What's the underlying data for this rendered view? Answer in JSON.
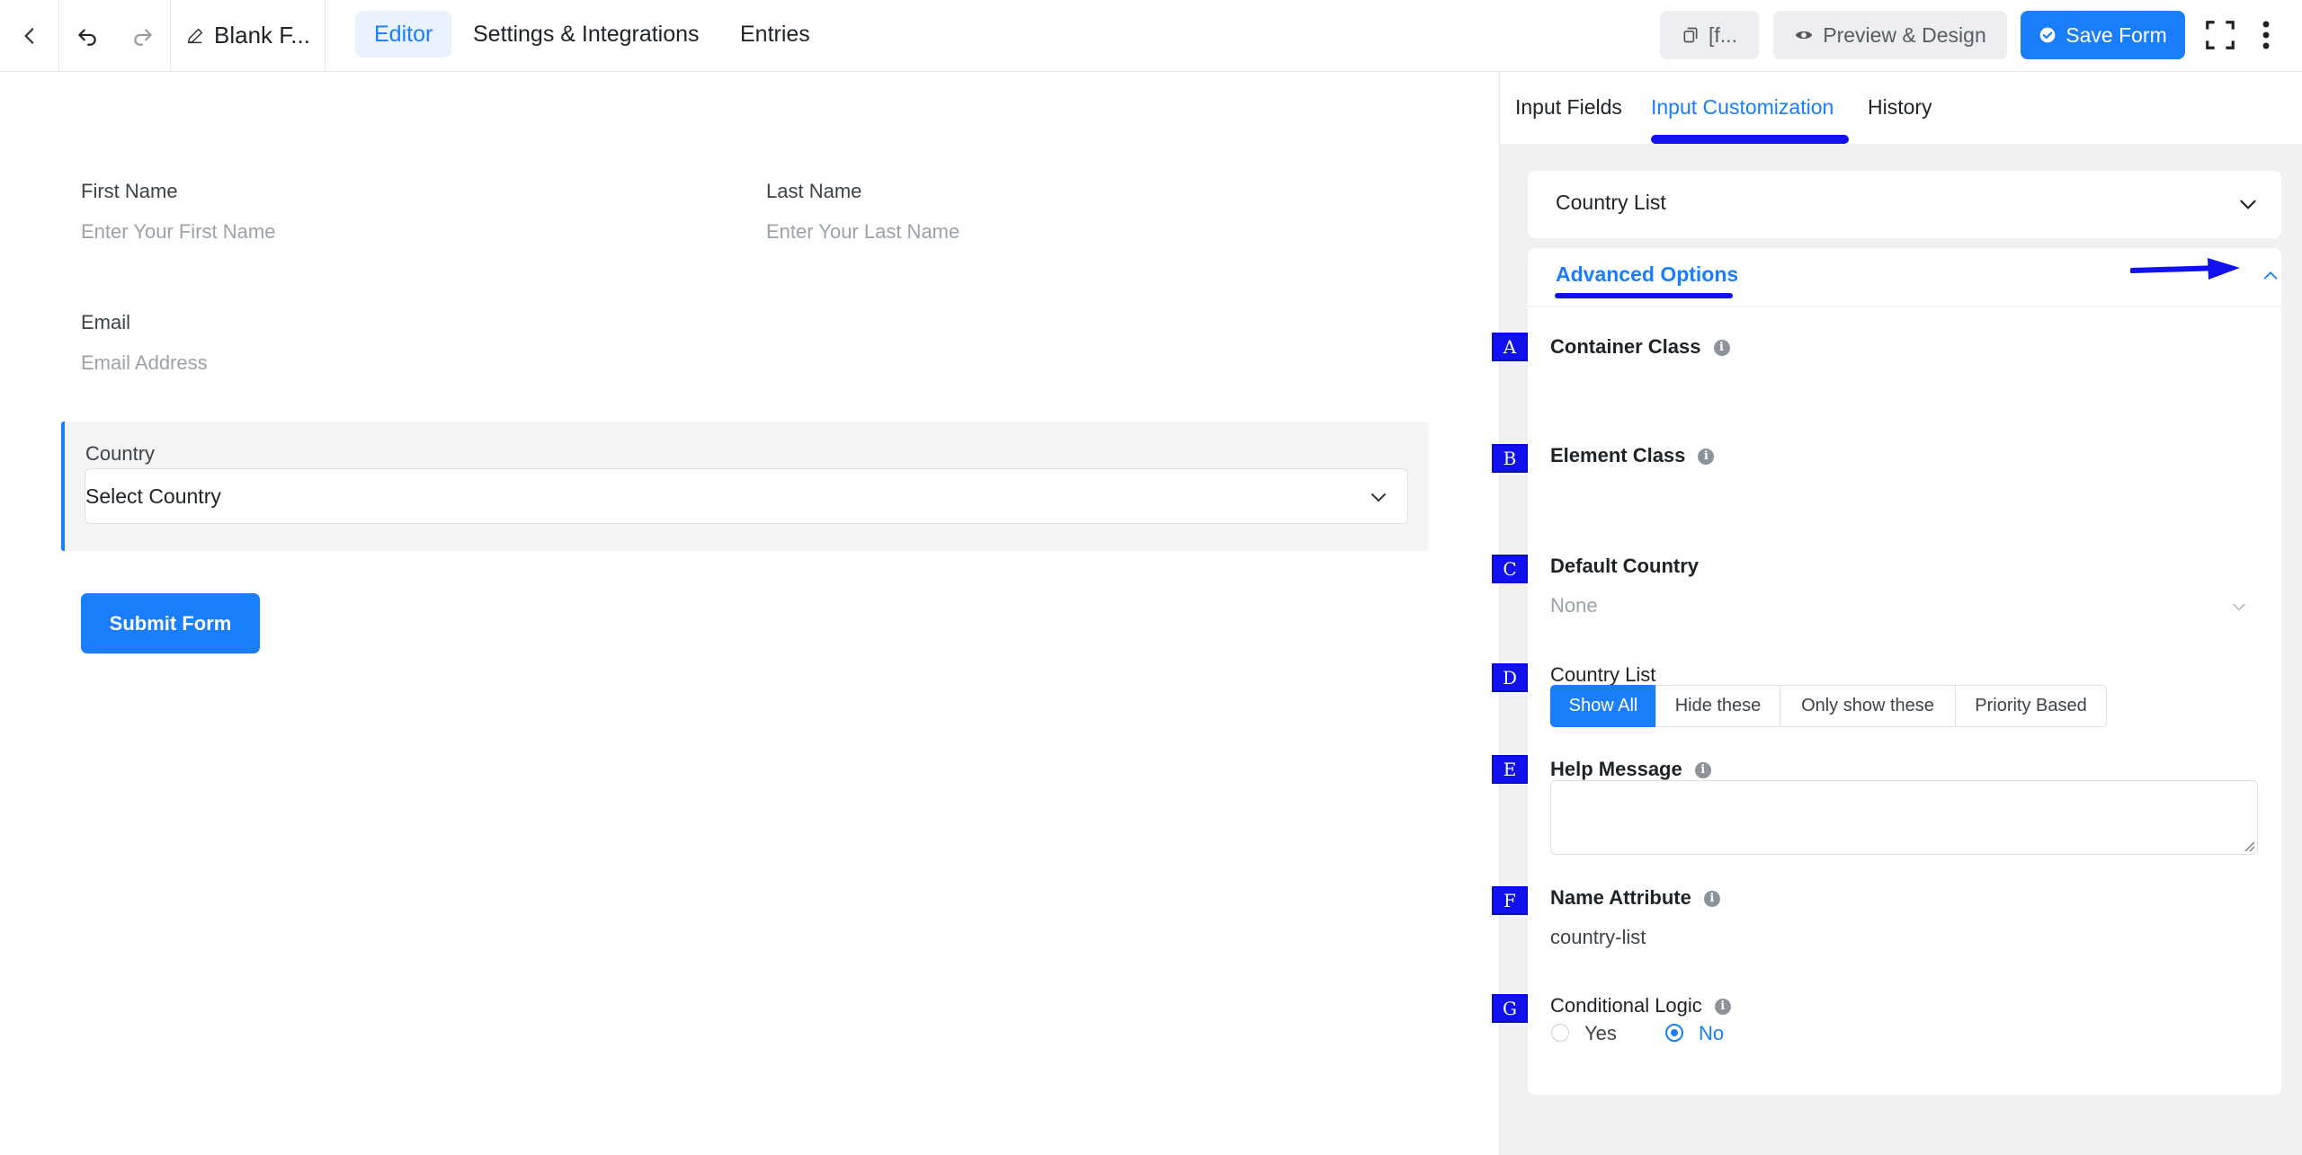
{
  "topbar": {
    "form_title": "Blank F...",
    "tabs": [
      {
        "label": "Editor",
        "active": true
      },
      {
        "label": "Settings & Integrations",
        "active": false
      },
      {
        "label": "Entries",
        "active": false
      }
    ],
    "shortcode_label": "[f...",
    "preview_label": "Preview & Design",
    "save_label": "Save Form"
  },
  "form": {
    "first_name": {
      "label": "First Name",
      "placeholder": "Enter Your First Name"
    },
    "last_name": {
      "label": "Last Name",
      "placeholder": "Enter Your Last Name"
    },
    "email": {
      "label": "Email",
      "placeholder": "Email Address"
    },
    "country": {
      "label": "Country",
      "value": "Select Country"
    },
    "submit_label": "Submit Form"
  },
  "panel": {
    "tabs": [
      {
        "label": "Input Fields",
        "active": false
      },
      {
        "label": "Input Customization",
        "active": true
      },
      {
        "label": "History",
        "active": false
      }
    ],
    "field_card_title": "Country List",
    "advanced_title": "Advanced Options",
    "options": {
      "container_class": {
        "badge": "A",
        "label": "Container Class"
      },
      "element_class": {
        "badge": "B",
        "label": "Element Class"
      },
      "default_country": {
        "badge": "C",
        "label": "Default Country",
        "value": "None"
      },
      "country_list": {
        "badge": "D",
        "label": "Country List",
        "segments": [
          "Show All",
          "Hide these",
          "Only show these",
          "Priority Based"
        ],
        "selected": "Show All"
      },
      "help_message": {
        "badge": "E",
        "label": "Help Message"
      },
      "name_attribute": {
        "badge": "F",
        "label": "Name Attribute",
        "value": "country-list"
      },
      "conditional_logic": {
        "badge": "G",
        "label": "Conditional Logic",
        "yes": "Yes",
        "no": "No",
        "selected": "No"
      }
    }
  },
  "colors": {
    "accent": "#1a7efb",
    "annotation": "#1111ee"
  }
}
